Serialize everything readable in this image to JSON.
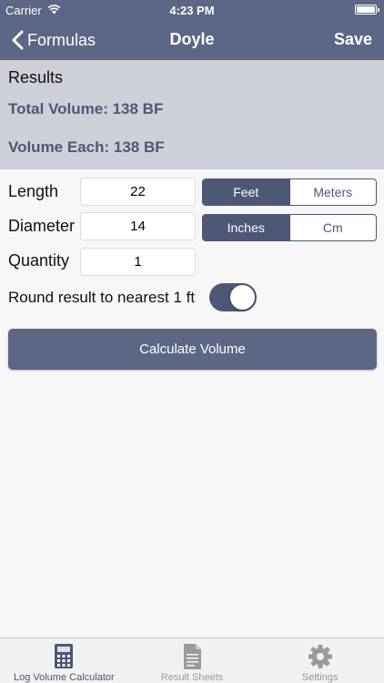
{
  "status_bar": {
    "carrier": "Carrier",
    "time": "4:23 PM"
  },
  "nav": {
    "back_label": "Formulas",
    "title": "Doyle",
    "save_label": "Save"
  },
  "results": {
    "heading": "Results",
    "total_volume": "Total Volume: 138 BF",
    "volume_each": "Volume Each: 138 BF"
  },
  "form": {
    "length": {
      "label": "Length",
      "value": "22",
      "units": [
        "Feet",
        "Meters"
      ],
      "selected": "Feet"
    },
    "diameter": {
      "label": "Diameter",
      "value": "14",
      "units": [
        "Inches",
        "Cm"
      ],
      "selected": "Inches"
    },
    "quantity": {
      "label": "Quantity",
      "value": "1"
    },
    "round": {
      "label": "Round result to nearest 1 ft",
      "enabled": true
    }
  },
  "calculate_label": "Calculate Volume",
  "tabs": [
    {
      "label": "Log Volume Calculator",
      "icon": "calculator-icon",
      "active": true
    },
    {
      "label": "Result Sheets",
      "icon": "document-icon",
      "active": false
    },
    {
      "label": "Settings",
      "icon": "gear-icon",
      "active": false
    }
  ],
  "colors": {
    "primary": "#5c6785",
    "accent": "#4d5776",
    "results_bg": "#cdd0d9",
    "tab_inactive": "#9a9a9a"
  }
}
